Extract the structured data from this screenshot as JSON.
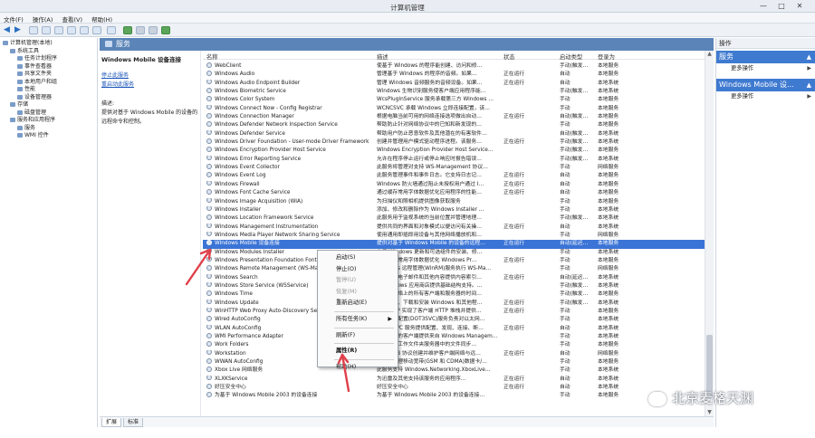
{
  "window": {
    "title": "计算机管理",
    "min": "—",
    "max": "□",
    "close": "✕"
  },
  "menu": [
    "文件(F)",
    "操作(A)",
    "查看(V)",
    "帮助(H)"
  ],
  "tree": [
    {
      "label": "计算机管理(本地)",
      "indent": 0
    },
    {
      "label": "系统工具",
      "indent": 1
    },
    {
      "label": "任务计划程序",
      "indent": 2
    },
    {
      "label": "事件查看器",
      "indent": 2
    },
    {
      "label": "共享文件夹",
      "indent": 2
    },
    {
      "label": "本地用户和组",
      "indent": 2
    },
    {
      "label": "性能",
      "indent": 2
    },
    {
      "label": "设备管理器",
      "indent": 2
    },
    {
      "label": "存储",
      "indent": 1
    },
    {
      "label": "磁盘管理",
      "indent": 2
    },
    {
      "label": "服务和应用程序",
      "indent": 1
    },
    {
      "label": "服务",
      "indent": 2
    },
    {
      "label": "WMI 控件",
      "indent": 2
    }
  ],
  "content_header": "服务",
  "desc_pane": {
    "service_title": "Windows Mobile 设备连接",
    "stop_link": "停止此服务",
    "restart_link": "重启动此服务",
    "desc_label": "描述:",
    "desc_line1": "提供对基于 Windows Mobile 的设备的",
    "desc_line2": "远程命令和控制。"
  },
  "columns": {
    "name": "名称",
    "desc": "描述",
    "status": "状态",
    "startup": "启动类型",
    "logon": "登录为"
  },
  "services": [
    {
      "name": "WebClient",
      "desc": "使基于 Windows 的程序能创建、访问和修…",
      "status": "",
      "startup": "手动(触发…",
      "logon": "本地服务"
    },
    {
      "name": "Windows Audio",
      "desc": "管理基于 Windows 的程序的音频。如果…",
      "status": "正在运行",
      "startup": "自动",
      "logon": "本地服务"
    },
    {
      "name": "Windows Audio Endpoint Builder",
      "desc": "管理 Windows 音频服务的音频设备。如果…",
      "status": "正在运行",
      "startup": "自动",
      "logon": "本地系统"
    },
    {
      "name": "Windows Biometric Service",
      "desc": "Windows 生物识别服务使客户端应用程序能…",
      "status": "",
      "startup": "手动(触发…",
      "logon": "本地系统"
    },
    {
      "name": "Windows Color System",
      "desc": "WcsPlugInService 服务承载第三方 Windows …",
      "status": "",
      "startup": "手动",
      "logon": "本地服务"
    },
    {
      "name": "Windows Connect Now - Config Registrar",
      "desc": "WCNCSVC 承载 Windows 立即连接配置，该…",
      "status": "",
      "startup": "手动",
      "logon": "本地服务"
    },
    {
      "name": "Windows Connection Manager",
      "desc": "根据电脑当前可用的网络连接选项做出自动…",
      "status": "正在运行",
      "startup": "自动(触发…",
      "logon": "本地服务"
    },
    {
      "name": "Windows Defender Network Inspection Service",
      "desc": "帮助防止针对网络协议中的已知和新发现的…",
      "status": "",
      "startup": "手动",
      "logon": "本地服务"
    },
    {
      "name": "Windows Defender Service",
      "desc": "帮助用户防止恶意软件及其他潜在的有害软件…",
      "status": "",
      "startup": "自动(触发…",
      "logon": "本地系统"
    },
    {
      "name": "Windows Driver Foundation - User-mode Driver Framework",
      "desc": "创建并管理用户模式驱动程序进程。该服务…",
      "status": "正在运行",
      "startup": "手动(触发…",
      "logon": "本地系统"
    },
    {
      "name": "Windows Encryption Provider Host Service",
      "desc": "Windows Encryption Provider Host Service…",
      "status": "",
      "startup": "手动(触发…",
      "logon": "本地服务"
    },
    {
      "name": "Windows Error Reporting Service",
      "desc": "允许在程序停止运行或停止响应时报告错误…",
      "status": "",
      "startup": "手动(触发…",
      "logon": "本地系统"
    },
    {
      "name": "Windows Event Collector",
      "desc": "此服务将管理对支持 WS-Management 协议…",
      "status": "",
      "startup": "手动",
      "logon": "网络服务"
    },
    {
      "name": "Windows Event Log",
      "desc": "此服务管理事件和事件日志。它支持日志记…",
      "status": "正在运行",
      "startup": "自动",
      "logon": "本地服务"
    },
    {
      "name": "Windows Firewall",
      "desc": "Windows 防火墙通过阻止未授权用户通过 I…",
      "status": "正在运行",
      "startup": "自动",
      "logon": "本地服务"
    },
    {
      "name": "Windows Font Cache Service",
      "desc": "通过缓存常用字体数据优化应用程序的性能…",
      "status": "正在运行",
      "startup": "自动",
      "logon": "本地服务"
    },
    {
      "name": "Windows Image Acquisition (WIA)",
      "desc": "为扫描仪和照相机提供图像获取服务",
      "status": "",
      "startup": "手动",
      "logon": "本地服务"
    },
    {
      "name": "Windows Installer",
      "desc": "添加、修改和删除作为 Windows Installer …",
      "status": "",
      "startup": "手动",
      "logon": "本地系统"
    },
    {
      "name": "Windows Location Framework Service",
      "desc": "此服务用于监视系统的当前位置并管理地理…",
      "status": "",
      "startup": "手动(触发…",
      "logon": "本地系统"
    },
    {
      "name": "Windows Management Instrumentation",
      "desc": "提供共同的界面和对象模式以便访问有关操…",
      "status": "正在运行",
      "startup": "自动",
      "logon": "本地系统"
    },
    {
      "name": "Windows Media Player Network Sharing Service",
      "desc": "使用通用即插即用设备与其他网络播放机和…",
      "status": "",
      "startup": "手动",
      "logon": "网络服务"
    },
    {
      "name": "Windows Mobile 设备连接",
      "desc": "提供对基于 Windows Mobile 的设备的远程…",
      "status": "正在运行",
      "startup": "自动(延迟…",
      "logon": "本地服务",
      "selected": true
    },
    {
      "name": "Windows Modules Installer",
      "desc": "启用 Windows 更新和可选组件的安装、修…",
      "status": "",
      "startup": "手动",
      "logon": "本地系统"
    },
    {
      "name": "Windows Presentation Foundation Font Cache 3.0.0.0",
      "desc": "通过缓存常用字体数据优化 Windows Pr…",
      "status": "正在运行",
      "startup": "手动",
      "logon": "本地服务"
    },
    {
      "name": "Windows Remote Management (WS-Management)",
      "desc": "Windows 远程管理(WinRM)服务执行 WS-Ma…",
      "status": "",
      "startup": "手动",
      "logon": "网络服务"
    },
    {
      "name": "Windows Search",
      "desc": "为文件、电子邮件和其他内容提供内容索引…",
      "status": "正在运行",
      "startup": "自动(延迟…",
      "logon": "本地系统"
    },
    {
      "name": "Windows Store Service (WSService)",
      "desc": "为 Windows 应用商店提供基础结构支持。…",
      "status": "",
      "startup": "手动(触发…",
      "logon": "本地系统"
    },
    {
      "name": "Windows Time",
      "desc": "维护在网络上的所有客户端和服务器的时间…",
      "status": "",
      "startup": "手动(触发…",
      "logon": "本地服务"
    },
    {
      "name": "Windows Update",
      "desc": "启用检测、下载和安装 Windows 和其他程…",
      "status": "正在运行",
      "startup": "手动(触发…",
      "logon": "本地系统"
    },
    {
      "name": "WinHTTP Web Proxy Auto-Discovery Service",
      "desc": "WinHTTP 实现了客户端 HTTP 堆栈并提供…",
      "status": "正在运行",
      "startup": "手动",
      "logon": "本地服务"
    },
    {
      "name": "Wired AutoConfig",
      "desc": "有线自动配置(DOT3SVC)服务负责对以太网…",
      "status": "",
      "startup": "手动",
      "logon": "本地系统"
    },
    {
      "name": "WLAN AutoConfig",
      "desc": "WLANSVC 服务提供配置、发现、连接、断…",
      "status": "正在运行",
      "startup": "自动",
      "logon": "本地系统"
    },
    {
      "name": "WMI Performance Adapter",
      "desc": "向网络上的客户端提供来自 Windows Managem…",
      "status": "",
      "startup": "手动",
      "logon": "本地系统"
    },
    {
      "name": "Work Folders",
      "desc": "此服务将工作文件夹服务器中的文件同步…",
      "status": "",
      "startup": "手动",
      "logon": "本地服务"
    },
    {
      "name": "Workstation",
      "desc": "使用 SMB 协议创建并维护客户端网络与远…",
      "status": "正在运行",
      "startup": "自动",
      "logon": "网络服务"
    },
    {
      "name": "WWAN AutoConfig",
      "desc": "该服务管理移动宽带(GSM 和 CDMA)数据卡/…",
      "status": "",
      "startup": "手动",
      "logon": "本地服务"
    },
    {
      "name": "Xbox Live 网络服务",
      "desc": "此服务支持 Windows.Networking.XboxLive…",
      "status": "",
      "startup": "手动",
      "logon": "本地系统"
    },
    {
      "name": "XLXKService",
      "desc": "为迅雷及其他支持该服务的应用程序…",
      "status": "正在运行",
      "startup": "自动",
      "logon": "本地系统"
    },
    {
      "name": "好压安全中心",
      "desc": "好压安全中心",
      "status": "正在运行",
      "startup": "自动",
      "logon": "本地系统"
    },
    {
      "name": "为基于 Windows Mobile 2003 的设备连接",
      "desc": "为基于 Windows Mobile 2003 的设备连接…",
      "status": "",
      "startup": "手动",
      "logon": "本地服务"
    }
  ],
  "context_menu": {
    "start": "启动(S)",
    "stop": "停止(O)",
    "pause": "暂停(U)",
    "resume": "恢复(M)",
    "restart": "重新启动(E)",
    "all_tasks": "所有任务(K)",
    "refresh": "刷新(F)",
    "properties": "属性(R)",
    "help": "帮助(H)"
  },
  "tabs": {
    "extended": "扩展",
    "standard": "标准"
  },
  "actions": {
    "header": "操作",
    "section1": "服务",
    "section1_more": "更多操作",
    "section2": "Windows Mobile 设…",
    "section2_more": "更多操作"
  },
  "watermark": "北京麦格天渊",
  "colors": {
    "selection": "#3b74d6",
    "header": "#5b84b8",
    "action_section": "#3f7ad1",
    "arrow": "#e0404a"
  }
}
